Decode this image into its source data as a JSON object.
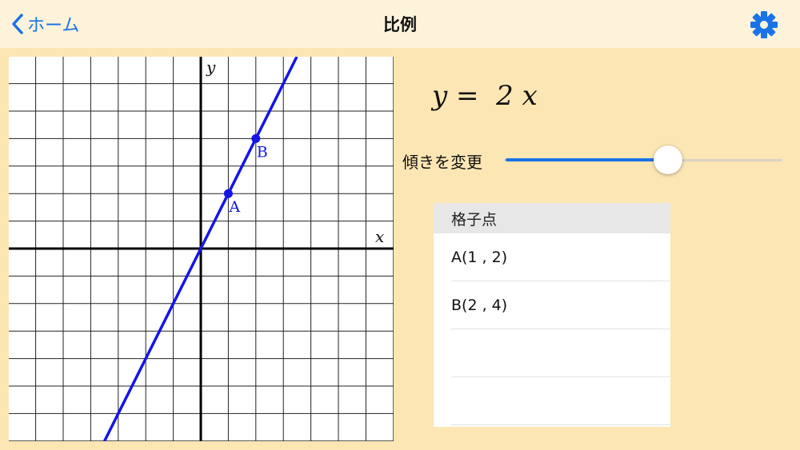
{
  "navbar": {
    "back_label": "ホーム",
    "title": "比例",
    "back_icon": "chevron-left-icon",
    "settings_icon": "gear-icon",
    "accent_color": "#1a73e8"
  },
  "graph": {
    "x_label": "x",
    "y_label": "y",
    "x_range": [
      -7,
      7
    ],
    "y_range": [
      -7,
      7
    ],
    "grid": true,
    "line": {
      "slope": 2,
      "color": "#1515e6"
    },
    "points": [
      {
        "name": "A",
        "x": 1,
        "y": 2
      },
      {
        "name": "B",
        "x": 2,
        "y": 4
      }
    ]
  },
  "equation": {
    "lhs": "y",
    "equals": "=",
    "coefficient": "2",
    "variable": "x"
  },
  "slider": {
    "label": "傾きを変更",
    "value_fraction": 0.6
  },
  "table": {
    "header": "格子点",
    "rows": [
      "A(1 , 2)",
      "B(2 , 4)",
      "",
      ""
    ]
  }
}
